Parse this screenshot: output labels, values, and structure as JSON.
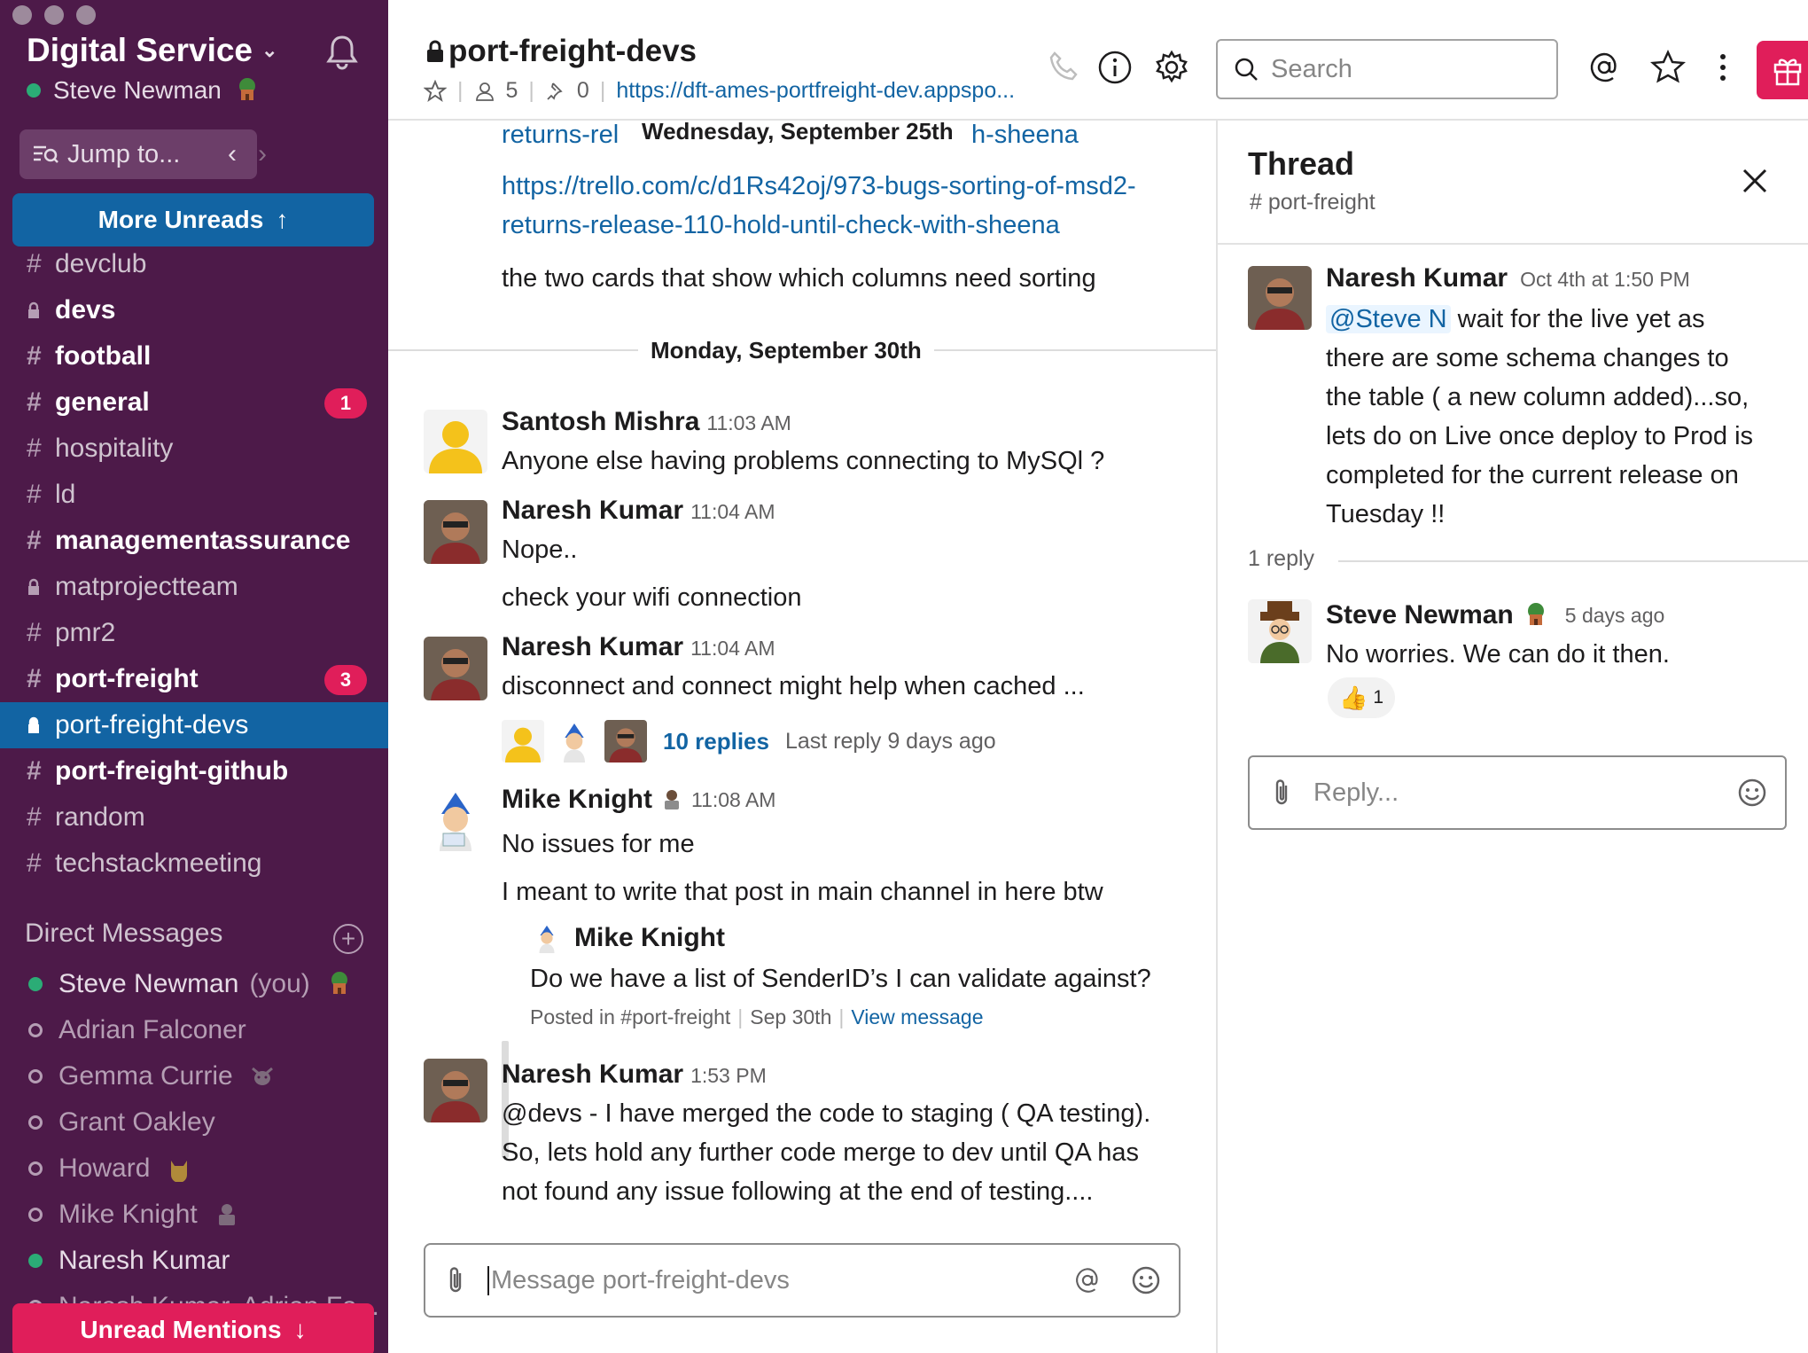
{
  "colors": {
    "sidebar_bg": "#4d1a49",
    "active": "#1264a3",
    "badge": "#e01e5a",
    "online": "#2bac76",
    "link": "#1264a3"
  },
  "sidebar": {
    "workspace_name": "Digital Service",
    "user_name": "Steve Newman",
    "jump_to": "Jump to...",
    "more_unreads": "More Unreads",
    "unread_mentions": "Unread Mentions",
    "channels": [
      {
        "name": "devclub",
        "prefix": "#",
        "bold": false,
        "private": false,
        "badge": ""
      },
      {
        "name": "devs",
        "prefix": "lock",
        "bold": true,
        "private": true,
        "badge": ""
      },
      {
        "name": "football",
        "prefix": "#",
        "bold": true,
        "private": false,
        "badge": ""
      },
      {
        "name": "general",
        "prefix": "#",
        "bold": true,
        "private": false,
        "badge": "1"
      },
      {
        "name": "hospitality",
        "prefix": "#",
        "bold": false,
        "private": false,
        "badge": ""
      },
      {
        "name": "ld",
        "prefix": "#",
        "bold": false,
        "private": false,
        "badge": ""
      },
      {
        "name": "managementassurance",
        "prefix": "#",
        "bold": true,
        "private": false,
        "badge": ""
      },
      {
        "name": "matprojectteam",
        "prefix": "lock",
        "bold": false,
        "private": true,
        "badge": ""
      },
      {
        "name": "pmr2",
        "prefix": "#",
        "bold": false,
        "private": false,
        "badge": ""
      },
      {
        "name": "port-freight",
        "prefix": "#",
        "bold": true,
        "private": false,
        "badge": "3"
      },
      {
        "name": "port-freight-devs",
        "prefix": "lock",
        "bold": false,
        "private": true,
        "badge": "",
        "active": true
      },
      {
        "name": "port-freight-github",
        "prefix": "#",
        "bold": true,
        "private": false,
        "badge": ""
      },
      {
        "name": "random",
        "prefix": "#",
        "bold": false,
        "private": false,
        "badge": ""
      },
      {
        "name": "techstackmeeting",
        "prefix": "#",
        "bold": false,
        "private": false,
        "badge": ""
      }
    ],
    "dm_header": "Direct Messages",
    "dms": [
      {
        "name": "Steve Newman",
        "suffix": "(you)",
        "online": true,
        "emoji": "tree-house"
      },
      {
        "name": "Adrian Falconer",
        "suffix": "",
        "online": false,
        "emoji": ""
      },
      {
        "name": "Gemma Currie",
        "suffix": "",
        "online": false,
        "emoji": "cow"
      },
      {
        "name": "Grant Oakley",
        "suffix": "",
        "online": false,
        "emoji": ""
      },
      {
        "name": "Howard",
        "suffix": "",
        "online": false,
        "emoji": "cat"
      },
      {
        "name": "Mike Knight",
        "suffix": "",
        "online": false,
        "emoji": "person"
      },
      {
        "name": "Naresh Kumar",
        "suffix": "",
        "online": true,
        "emoji": ""
      },
      {
        "name": "Naresh Kumar, Adrian Fa...",
        "suffix": "",
        "online": false,
        "emoji": ""
      }
    ]
  },
  "header": {
    "channel_name": "port-freight-devs",
    "members": "5",
    "pins": "0",
    "topic_link": "https://dft-ames-portfreight-dev.appspo...",
    "search_placeholder": "Search"
  },
  "messages": {
    "top_link_line1_partial": "returns-rel",
    "top_link_line1_partial_right": "h-sheena",
    "floating_date": "Wednesday, September 25th",
    "trello_link_line1": "https://trello.com/c/d1Rs42oj/973-bugs-sorting-of-msd2-",
    "trello_link_line2": "returns-release-110-hold-until-check-with-sheena",
    "cards_text": "the two cards that show which columns need sorting",
    "date_divider": "Monday, September 30th",
    "m1": {
      "author": "Santosh Mishra",
      "time": "11:03 AM",
      "text": "Anyone else having problems connecting to MySQl ?"
    },
    "m2": {
      "author": "Naresh Kumar",
      "time": "11:04 AM",
      "text": "Nope..",
      "text2": "check your wifi connection"
    },
    "m3": {
      "author": "Naresh Kumar",
      "time": "11:04 AM",
      "text": "disconnect and connect might help when cached ...",
      "replies": "10 replies",
      "last_reply": "Last reply 9 days ago"
    },
    "m4": {
      "author": "Mike Knight",
      "time": "11:08 AM",
      "text": "No issues for me",
      "text2": "I meant to write that post in main channel in here btw",
      "quote_author": "Mike Knight",
      "quote_text": "Do we have a list of SenderID’s I can validate against?",
      "quote_posted": "Posted in #port-freight",
      "quote_date": "Sep 30th",
      "quote_view": "View message"
    },
    "m5": {
      "author": "Naresh Kumar",
      "time": "1:53 PM",
      "line1": "@devs - I have merged the code to staging ( QA testing).",
      "line2": "So, lets hold any further code merge to dev until QA has",
      "line3": "not found any issue following at the end of testing...."
    },
    "composer_placeholder": "Message port-freight-devs"
  },
  "thread": {
    "title": "Thread",
    "channel": "# port-freight",
    "parent": {
      "author": "Naresh Kumar",
      "time": "Oct 4th at 1:50 PM",
      "mention": "@Steve N",
      "line1": " wait for the live yet as",
      "line2": "there are some schema changes to",
      "line3": "the table ( a new column added)...so,",
      "line4": "lets do on Live once deploy to Prod is",
      "line5": "completed for the current release on",
      "line6": "Tuesday !!"
    },
    "reply_count": "1 reply",
    "reply": {
      "author": "Steve Newman",
      "time": "5 days ago",
      "text": "No worries. We can do it then.",
      "reaction_count": "1"
    },
    "reply_placeholder": "Reply..."
  }
}
